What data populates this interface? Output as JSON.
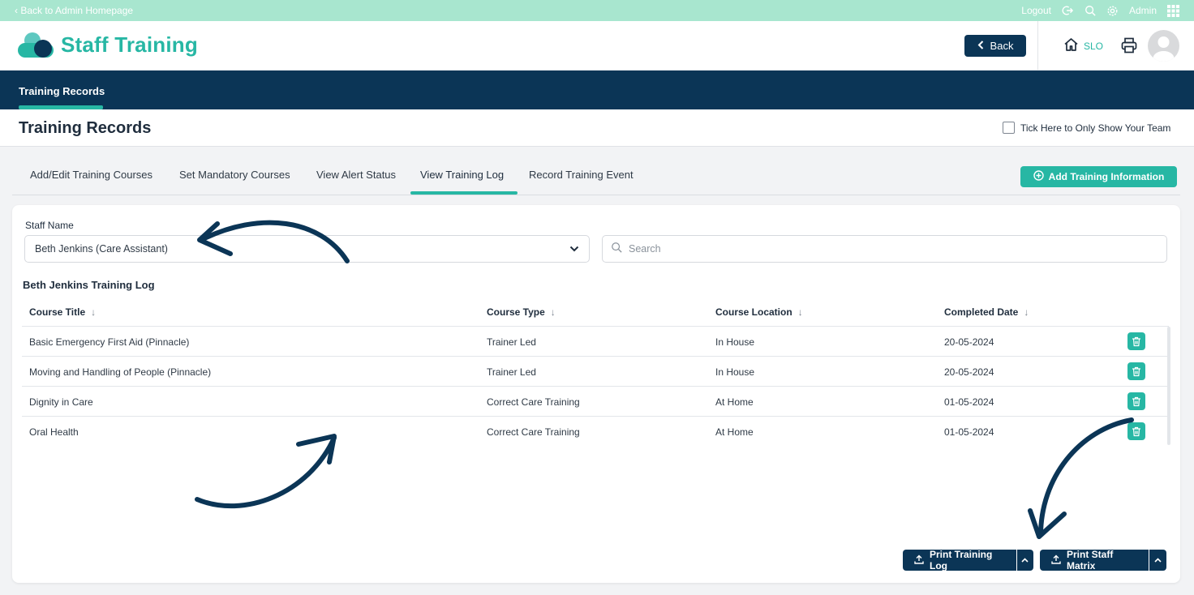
{
  "topbar": {
    "back_link": "‹ Back to Admin Homepage",
    "logout": "Logout",
    "user": "Admin"
  },
  "header": {
    "app_title": "Staff Training",
    "back_button": "Back",
    "home_label": "SLO"
  },
  "nav": {
    "active_tab": "Training Records"
  },
  "page": {
    "title": "Training Records",
    "team_filter_label": "Tick Here to Only Show Your Team",
    "team_filter_checked": false
  },
  "subtabs": [
    {
      "label": "Add/Edit Training Courses",
      "active": false
    },
    {
      "label": "Set Mandatory Courses",
      "active": false
    },
    {
      "label": "View Alert Status",
      "active": false
    },
    {
      "label": "View Training Log",
      "active": true
    },
    {
      "label": "Record Training Event",
      "active": false
    }
  ],
  "add_button": "Add Training Information",
  "form": {
    "staff_label": "Staff Name",
    "staff_value": "Beth Jenkins (Care Assistant)",
    "search_placeholder": "Search"
  },
  "log": {
    "title": "Beth Jenkins Training Log",
    "columns": [
      "Course Title",
      "Course Type",
      "Course Location",
      "Completed Date"
    ],
    "rows": [
      [
        "Basic Emergency First Aid (Pinnacle)",
        "Trainer Led",
        "In House",
        "20-05-2024"
      ],
      [
        "Moving and Handling of People (Pinnacle)",
        "Trainer Led",
        "In House",
        "20-05-2024"
      ],
      [
        "Dignity in Care",
        "Correct Care Training",
        "At Home",
        "01-05-2024"
      ],
      [
        "Oral Health",
        "Correct Care Training",
        "At Home",
        "01-05-2024"
      ]
    ]
  },
  "actions": {
    "print_log": "Print Training Log",
    "print_matrix": "Print Staff Matrix"
  },
  "colors": {
    "teal": "#27b7a4",
    "navy": "#0b3556",
    "mint": "#a8e6cf"
  },
  "icons": [
    "search-icon",
    "gear-icon",
    "grid-icon",
    "home-icon",
    "printer-icon",
    "trash-icon",
    "upload-icon",
    "chevron-down-icon",
    "chevron-up-icon",
    "plus-circle-icon"
  ]
}
